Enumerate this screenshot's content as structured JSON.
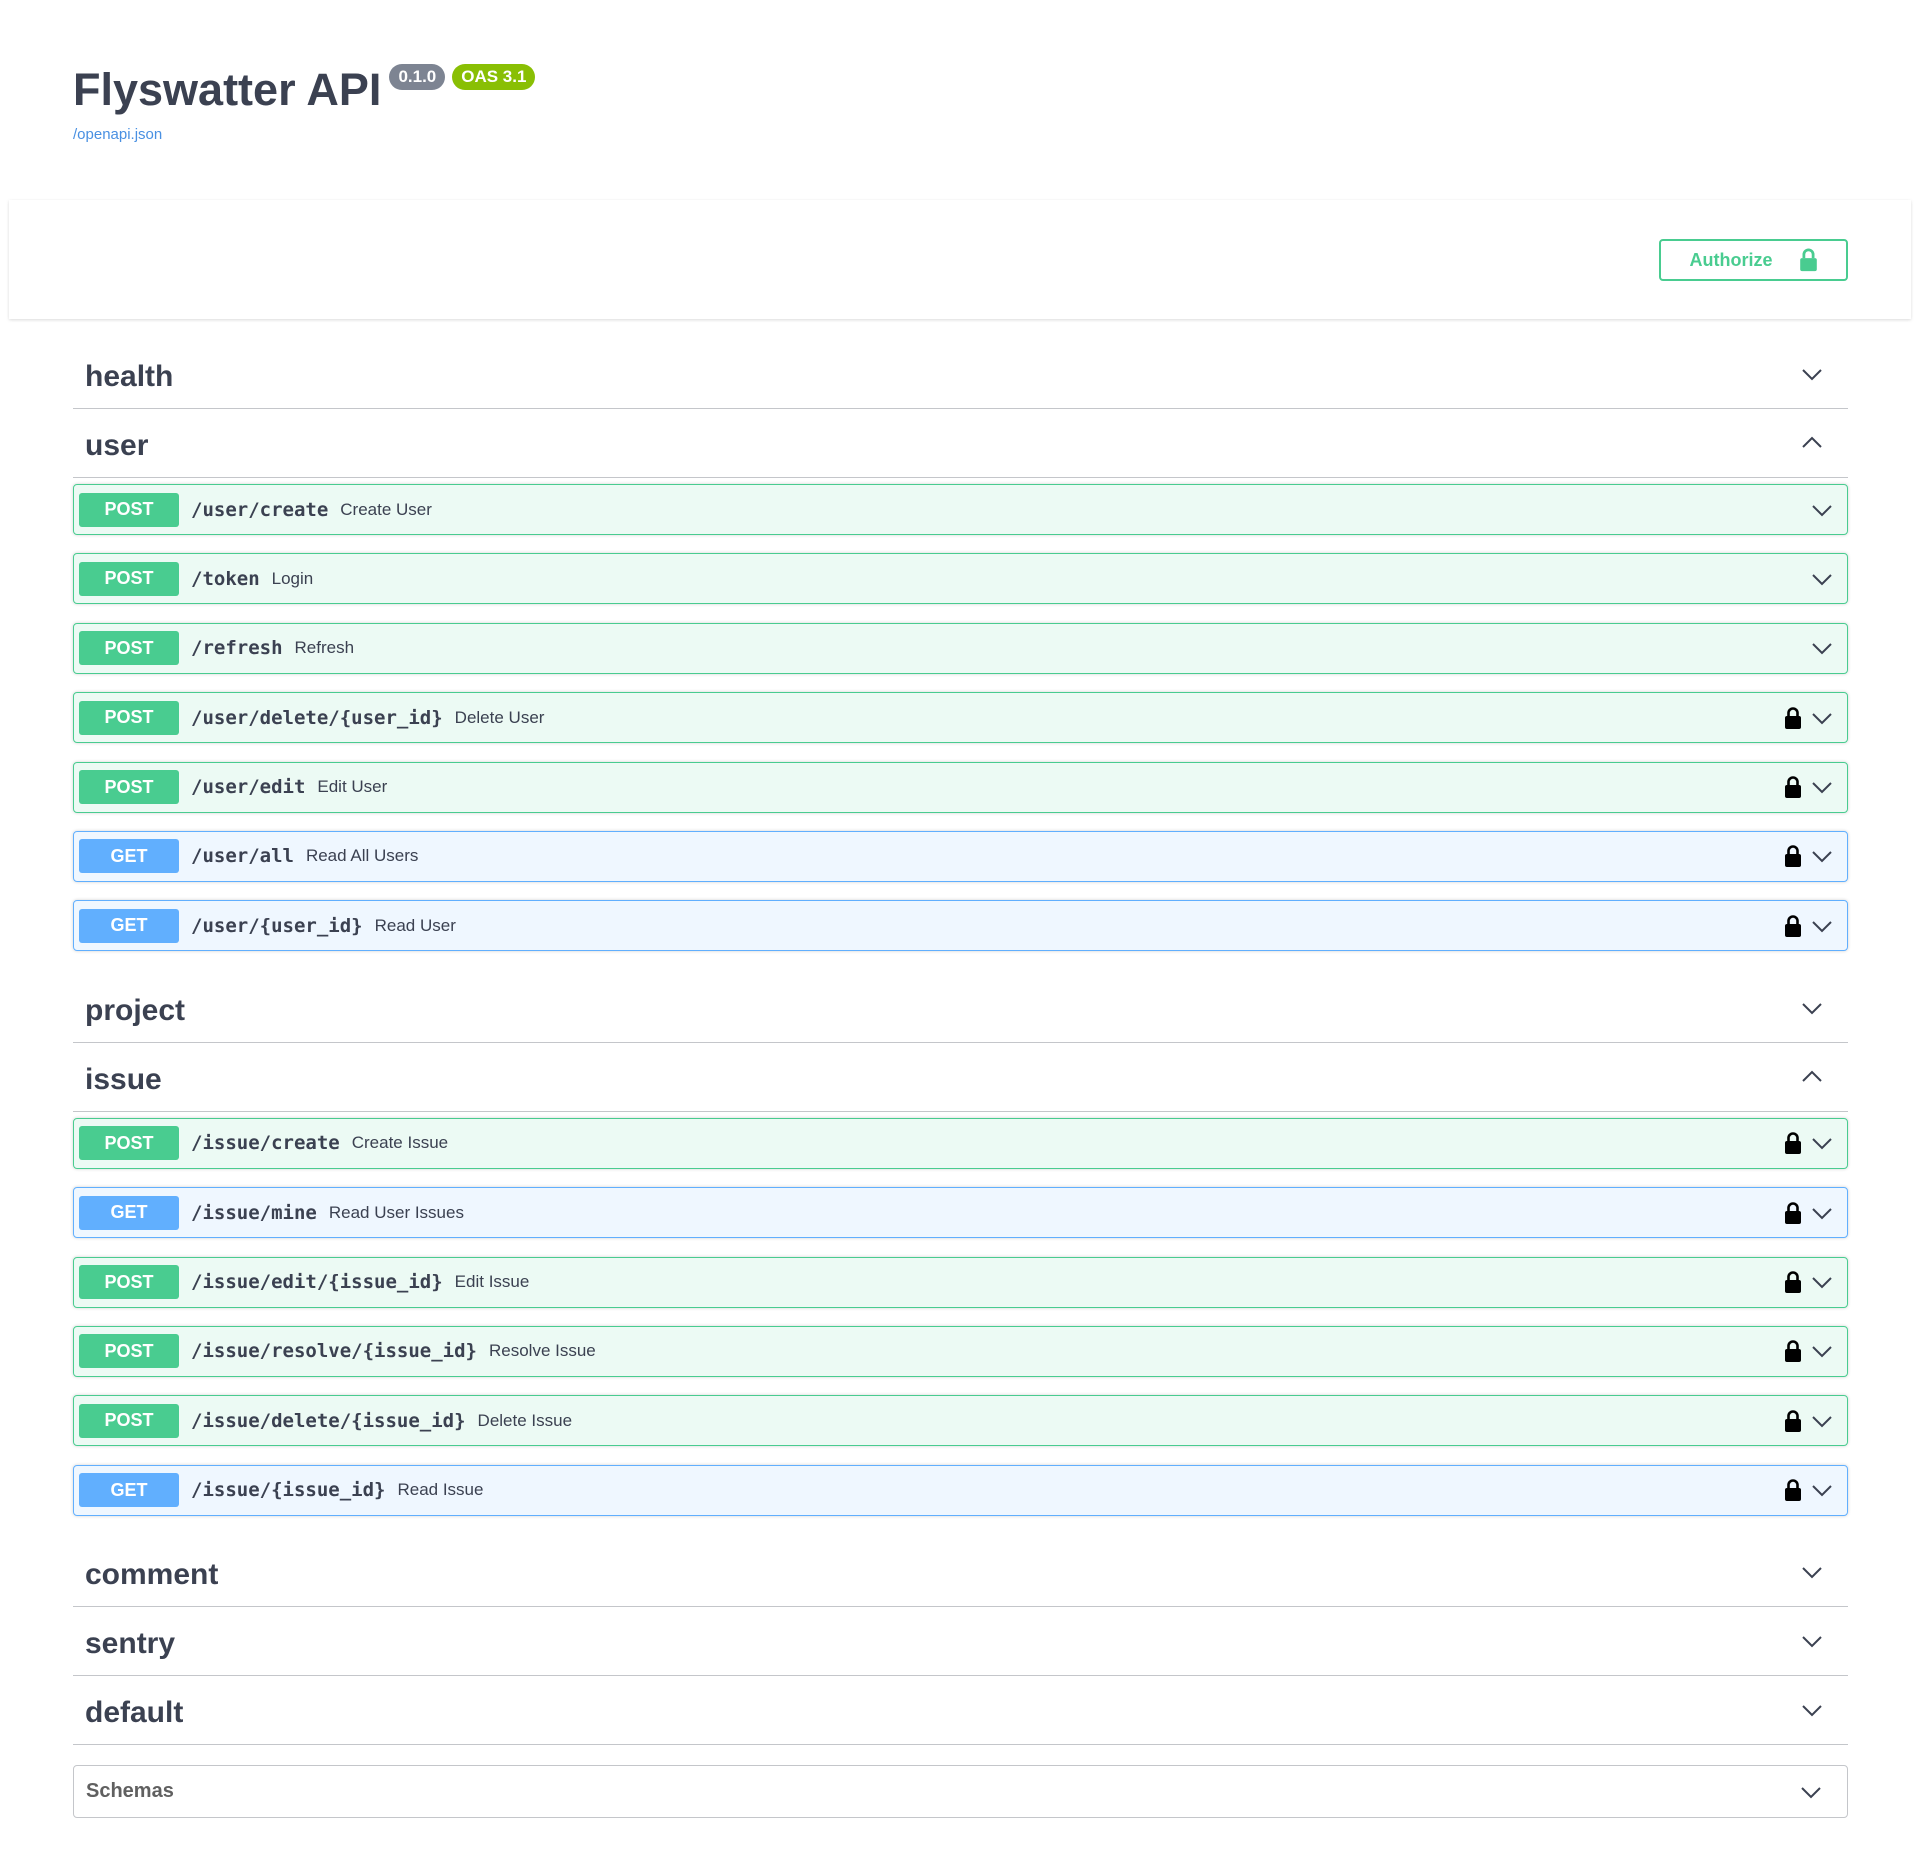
{
  "info": {
    "title": "Flyswatter API",
    "version": "0.1.0",
    "oas": "OAS 3.1",
    "spec_link": "/openapi.json"
  },
  "authorize": {
    "label": "Authorize",
    "icon": "lock-icon"
  },
  "colors": {
    "post": "#49cc90",
    "get": "#61affe",
    "text": "#3b4151",
    "link": "#4990e2"
  },
  "tags": [
    {
      "name": "health",
      "expanded": false,
      "operations": []
    },
    {
      "name": "user",
      "expanded": true,
      "operations": [
        {
          "method": "POST",
          "path": "/user/create",
          "summary": "Create User",
          "locked": false
        },
        {
          "method": "POST",
          "path": "/token",
          "summary": "Login",
          "locked": false
        },
        {
          "method": "POST",
          "path": "/refresh",
          "summary": "Refresh",
          "locked": false
        },
        {
          "method": "POST",
          "path": "/user/delete/{user_id}",
          "summary": "Delete User",
          "locked": true
        },
        {
          "method": "POST",
          "path": "/user/edit",
          "summary": "Edit User",
          "locked": true
        },
        {
          "method": "GET",
          "path": "/user/all",
          "summary": "Read All Users",
          "locked": true
        },
        {
          "method": "GET",
          "path": "/user/{user_id}",
          "summary": "Read User",
          "locked": true
        }
      ]
    },
    {
      "name": "project",
      "expanded": false,
      "operations": []
    },
    {
      "name": "issue",
      "expanded": true,
      "operations": [
        {
          "method": "POST",
          "path": "/issue/create",
          "summary": "Create Issue",
          "locked": true
        },
        {
          "method": "GET",
          "path": "/issue/mine",
          "summary": "Read User Issues",
          "locked": true
        },
        {
          "method": "POST",
          "path": "/issue/edit/{issue_id}",
          "summary": "Edit Issue",
          "locked": true
        },
        {
          "method": "POST",
          "path": "/issue/resolve/{issue_id}",
          "summary": "Resolve Issue",
          "locked": true
        },
        {
          "method": "POST",
          "path": "/issue/delete/{issue_id}",
          "summary": "Delete Issue",
          "locked": true
        },
        {
          "method": "GET",
          "path": "/issue/{issue_id}",
          "summary": "Read Issue",
          "locked": true
        }
      ]
    },
    {
      "name": "comment",
      "expanded": false,
      "operations": []
    },
    {
      "name": "sentry",
      "expanded": false,
      "operations": []
    },
    {
      "name": "default",
      "expanded": false,
      "operations": []
    }
  ],
  "schemas": {
    "title": "Schemas"
  }
}
